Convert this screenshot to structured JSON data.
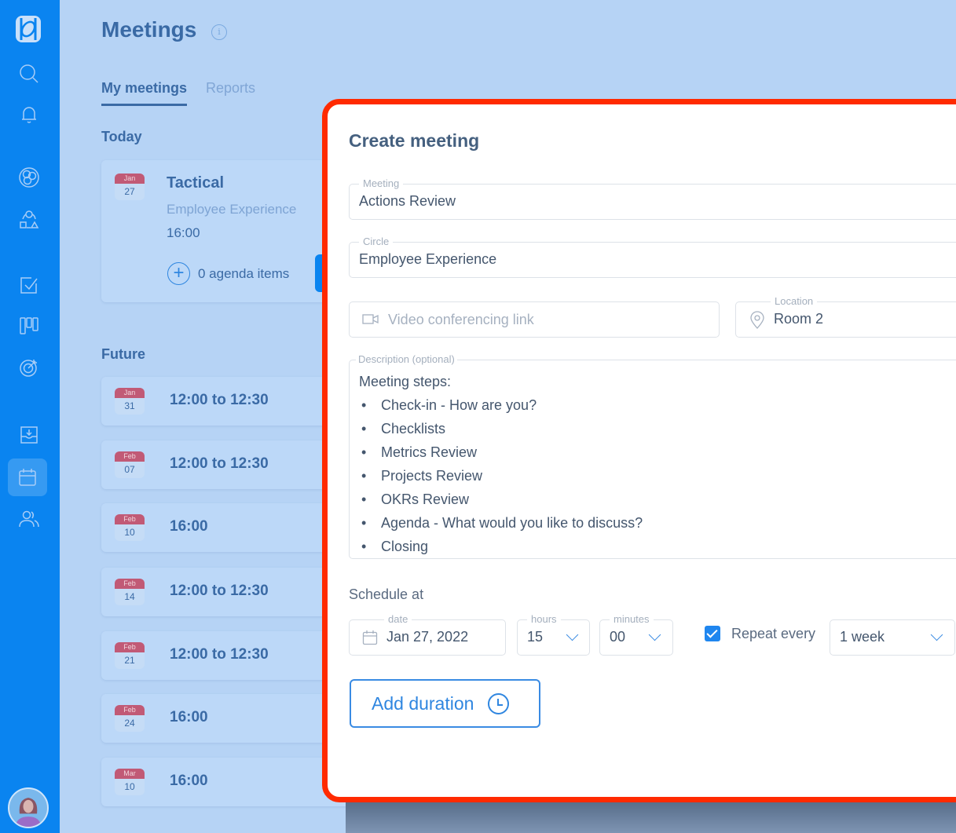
{
  "sidebar": {
    "logo": "app-logo",
    "items": [
      {
        "icon": "search-icon"
      },
      {
        "icon": "bell-icon"
      },
      {
        "icon": "circles-icon"
      },
      {
        "icon": "roles-icon"
      },
      {
        "icon": "checklist-icon"
      },
      {
        "icon": "kanban-icon"
      },
      {
        "icon": "target-icon"
      },
      {
        "icon": "inbox-icon"
      },
      {
        "icon": "calendar-icon",
        "active": true
      },
      {
        "icon": "people-icon"
      }
    ],
    "avatar": "user-avatar"
  },
  "header": {
    "title": "Meetings",
    "info_icon": "i"
  },
  "tabs": [
    {
      "label": "My meetings",
      "active": true
    },
    {
      "label": "Reports",
      "active": false
    }
  ],
  "today": {
    "heading": "Today",
    "meeting": {
      "month": "Jan",
      "day": "27",
      "title": "Tactical",
      "circle": "Employee Experience",
      "time": "16:00",
      "agenda_add": "+",
      "agenda": "0 agenda items"
    }
  },
  "future": {
    "heading": "Future",
    "meetings": [
      {
        "month": "Jan",
        "day": "31",
        "time": "12:00 to 12:30"
      },
      {
        "month": "Feb",
        "day": "07",
        "time": "12:00 to 12:30"
      },
      {
        "month": "Feb",
        "day": "10",
        "time": "16:00"
      },
      {
        "month": "Feb",
        "day": "14",
        "time": "12:00 to 12:30"
      },
      {
        "month": "Feb",
        "day": "21",
        "time": "12:00 to 12:30"
      },
      {
        "month": "Feb",
        "day": "24",
        "time": "16:00"
      },
      {
        "month": "Mar",
        "day": "10",
        "time": "16:00"
      }
    ]
  },
  "modal": {
    "title": "Create meeting",
    "meeting": {
      "label": "Meeting",
      "value": "Actions Review"
    },
    "circle": {
      "label": "Circle",
      "value": "Employee Experience"
    },
    "video": {
      "placeholder": "Video conferencing link"
    },
    "location": {
      "label": "Location",
      "value": "Room 2"
    },
    "description": {
      "label": "Description (optional)",
      "heading": "Meeting steps:",
      "steps": [
        "Check-in - How are you?",
        "Checklists",
        "Metrics  Review",
        "Projects Review",
        "OKRs Review",
        "Agenda  - What would you like to discuss?",
        "Closing"
      ]
    },
    "schedule": {
      "label": "Schedule at",
      "date": {
        "label": "date",
        "value": "Jan 27, 2022"
      },
      "hours": {
        "label": "hours",
        "value": "15"
      },
      "minutes": {
        "label": "minutes",
        "value": "00"
      },
      "repeat": {
        "checked": true,
        "label": "Repeat every",
        "value": "1 week"
      }
    },
    "add_duration": "Add duration"
  },
  "colors": {
    "sidebar": "#0a84f0",
    "background": "#b6d3f5",
    "highlight_border": "#ff2a00",
    "accent": "#2f86e0",
    "calendar_month": "#c15a76"
  }
}
